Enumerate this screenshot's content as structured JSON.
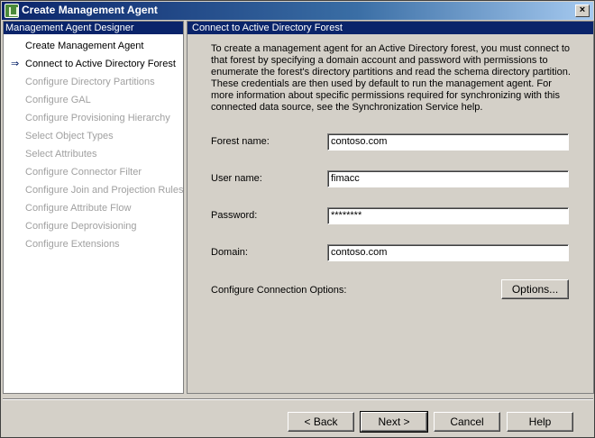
{
  "window": {
    "title": "Create Management Agent",
    "close_glyph": "×"
  },
  "designer": {
    "header": "Management Agent Designer",
    "current_arrow": "⇒",
    "steps": [
      {
        "label": "Create Management Agent",
        "state": "done"
      },
      {
        "label": "Connect to Active Directory Forest",
        "state": "current"
      },
      {
        "label": "Configure Directory Partitions",
        "state": "disabled"
      },
      {
        "label": "Configure GAL",
        "state": "disabled"
      },
      {
        "label": "Configure Provisioning Hierarchy",
        "state": "disabled"
      },
      {
        "label": "Select Object Types",
        "state": "disabled"
      },
      {
        "label": "Select Attributes",
        "state": "disabled"
      },
      {
        "label": "Configure Connector Filter",
        "state": "disabled"
      },
      {
        "label": "Configure Join and Projection Rules",
        "state": "disabled"
      },
      {
        "label": "Configure Attribute Flow",
        "state": "disabled"
      },
      {
        "label": "Configure Deprovisioning",
        "state": "disabled"
      },
      {
        "label": "Configure Extensions",
        "state": "disabled"
      }
    ]
  },
  "page": {
    "header": "Connect to Active Directory Forest",
    "description": "To create a management agent for an Active Directory forest, you must connect to that forest by specifying a domain account and password with permissions to enumerate the forest's directory partitions and read the schema directory partition. These credentials are then used by default to run the management agent. For more information about specific permissions required for synchronizing with this connected data source, see the Synchronization Service help.",
    "forest_name": {
      "label": "Forest name:",
      "value": "contoso.com"
    },
    "user_name": {
      "label": "User name:",
      "value": "fimacc"
    },
    "password": {
      "label": "Password:",
      "value": "********"
    },
    "domain": {
      "label": "Domain:",
      "value": "contoso.com"
    },
    "connection_options": {
      "label": "Configure Connection Options:",
      "button": "Options..."
    }
  },
  "footer": {
    "back": "< Back",
    "next": "Next >",
    "cancel": "Cancel",
    "help": "Help"
  },
  "colors": {
    "header_bg": "#0a246a",
    "dialog_bg": "#d4d0c8",
    "disabled_text": "#a0a0a0"
  }
}
